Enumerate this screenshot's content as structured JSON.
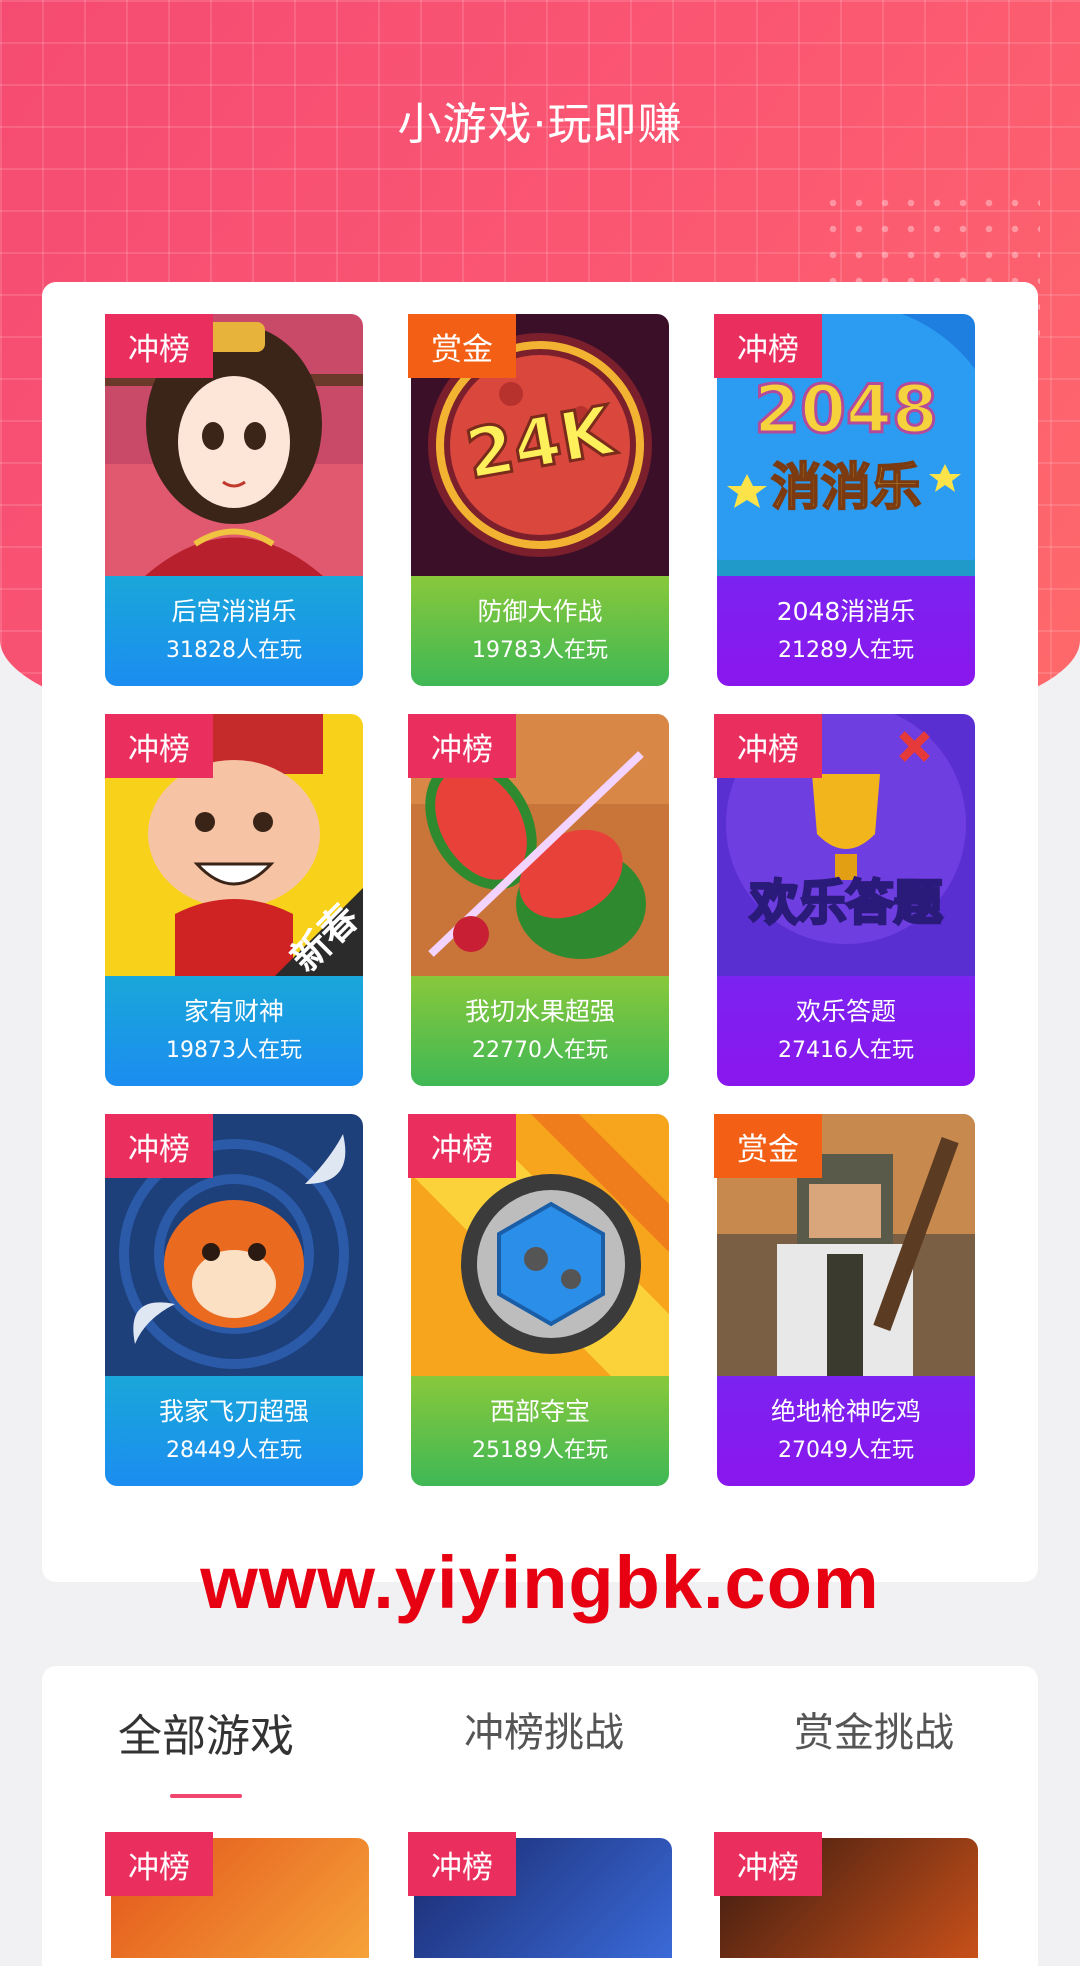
{
  "header": {
    "title": "小游戏·玩即赚"
  },
  "badges": {
    "rank": "冲榜",
    "bounty": "赏金"
  },
  "games": [
    {
      "name": "后宫消消乐",
      "count": "31828人在玩",
      "badge": "冲榜",
      "theme": "blue",
      "art_text": ""
    },
    {
      "name": "防御大作战",
      "count": "19783人在玩",
      "badge": "赏金",
      "theme": "green",
      "art_text": "24K"
    },
    {
      "name": "2048消消乐",
      "count": "21289人在玩",
      "badge": "冲榜",
      "theme": "purple",
      "art_text": "2048\n消消乐"
    },
    {
      "name": "家有财神",
      "count": "19873人在玩",
      "badge": "冲榜",
      "theme": "blue",
      "art_text": "新春"
    },
    {
      "name": "我切水果超强",
      "count": "22770人在玩",
      "badge": "冲榜",
      "theme": "green",
      "art_text": ""
    },
    {
      "name": "欢乐答题",
      "count": "27416人在玩",
      "badge": "冲榜",
      "theme": "purple",
      "art_text": "欢乐答题"
    },
    {
      "name": "我家飞刀超强",
      "count": "28449人在玩",
      "badge": "冲榜",
      "theme": "blue",
      "art_text": ""
    },
    {
      "name": "西部夺宝",
      "count": "25189人在玩",
      "badge": "冲榜",
      "theme": "green",
      "art_text": ""
    },
    {
      "name": "绝地枪神吃鸡",
      "count": "27049人在玩",
      "badge": "赏金",
      "theme": "purple",
      "art_text": ""
    }
  ],
  "watermark": "www.yiyingbk.com",
  "tabs": [
    {
      "label": "全部游戏",
      "active": true
    },
    {
      "label": "冲榜挑战",
      "active": false
    },
    {
      "label": "赏金挑战",
      "active": false
    }
  ],
  "bottom_badges": [
    "冲榜",
    "冲榜",
    "冲榜"
  ],
  "colors": {
    "header_pink": "#f54b72",
    "badge_rank": "#ea2f5e",
    "badge_bounty": "#f36015",
    "tab_underline": "#f0466e",
    "watermark": "#e60012"
  }
}
